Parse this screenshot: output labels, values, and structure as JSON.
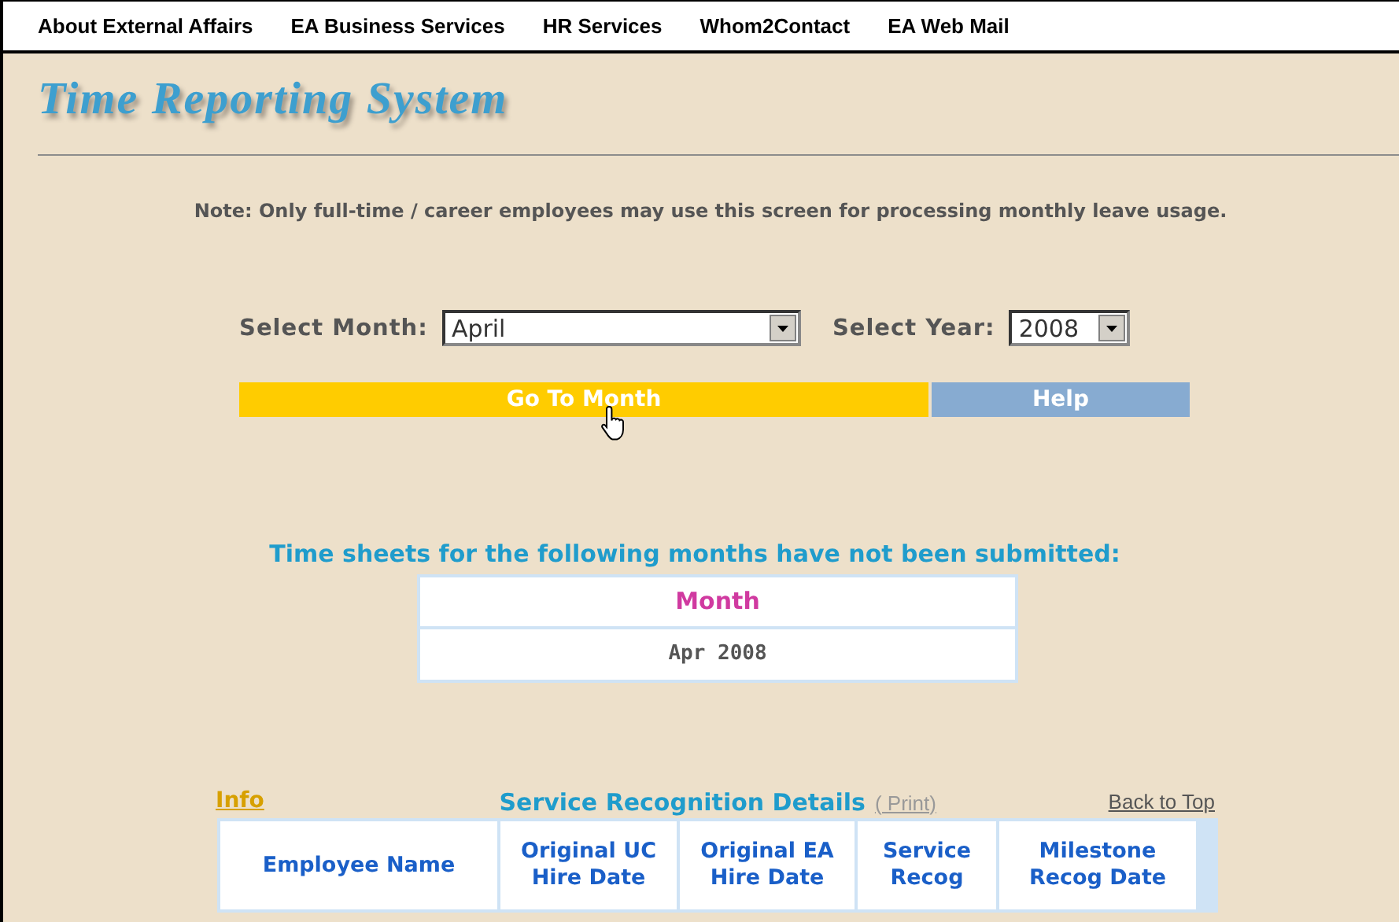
{
  "nav": [
    "About External Affairs",
    "EA Business Services",
    "HR Services",
    "Whom2Contact",
    "EA Web Mail"
  ],
  "title": "Time Reporting System",
  "note": "Note: Only full-time / career employees may use this screen for processing monthly leave usage.",
  "month_field": {
    "label": "Select Month:",
    "value": "April"
  },
  "year_field": {
    "label": "Select Year:",
    "value": "2008"
  },
  "buttons": [
    {
      "label": "Go To Month",
      "kind": "primary"
    },
    {
      "label": "Help",
      "kind": "secondary"
    }
  ],
  "pending": {
    "heading": "Time sheets for the following months have not been submitted:",
    "column": "Month",
    "rows": [
      "Apr 2008"
    ]
  },
  "details": {
    "info_link": "Info",
    "title": "Service Recognition Details",
    "print_link": "( Print)",
    "back_link": "Back to Top",
    "columns": [
      "Employee Name",
      "Original UC Hire Date",
      "Original EA Hire Date",
      "Service Recog",
      "Milestone Recog Date"
    ]
  }
}
